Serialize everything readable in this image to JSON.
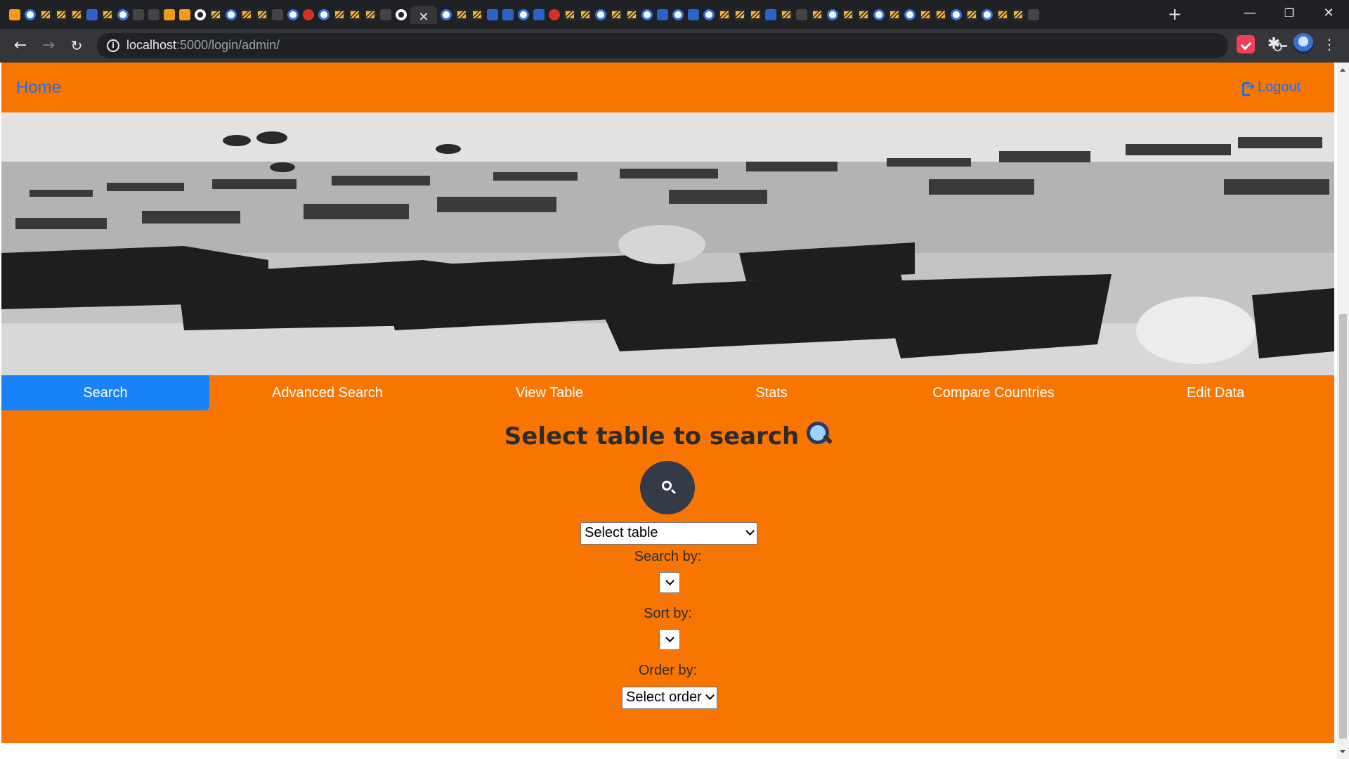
{
  "browser": {
    "url_host": "localhost",
    "url_rest": ":5000/login/admin/",
    "tab_close_glyph": "✕",
    "new_tab_glyph": "+",
    "favicons": [
      "o",
      "g",
      "w",
      "w",
      "w",
      "b",
      "w",
      "g",
      "dark",
      "dark",
      "o",
      "o",
      "c",
      "w",
      "g",
      "w",
      "w",
      "dark",
      "g",
      "r",
      "g",
      "w",
      "w",
      "w",
      "dark",
      "c",
      "active",
      "g",
      "w",
      "w",
      "b",
      "b",
      "g",
      "b",
      "r",
      "w",
      "w",
      "g",
      "w",
      "w",
      "g",
      "b",
      "g",
      "b",
      "g",
      "w",
      "w",
      "w",
      "b",
      "w",
      "dark",
      "w",
      "g",
      "w",
      "w",
      "g",
      "w",
      "g",
      "w",
      "w",
      "g",
      "w",
      "g",
      "w",
      "w",
      "dark"
    ],
    "controls": {
      "minimize": "—",
      "restore": "❐",
      "close": "✕"
    },
    "icons": [
      "back-arrow-icon",
      "forward-arrow-icon",
      "reload-icon",
      "info-icon",
      "key-icon",
      "star-icon",
      "pocket-icon",
      "puzzle-icon",
      "avatar",
      "menu-icon"
    ]
  },
  "nav": {
    "home": "Home",
    "logout": "Logout"
  },
  "tabs": [
    {
      "label": "Search",
      "active": true
    },
    {
      "label": "Advanced Search",
      "active": false
    },
    {
      "label": "View Table",
      "active": false
    },
    {
      "label": "Stats",
      "active": false
    },
    {
      "label": "Compare Countries",
      "active": false
    },
    {
      "label": "Edit Data",
      "active": false
    }
  ],
  "main": {
    "heading": "Select table to search",
    "table_select": "Select table",
    "search_by_label": "Search by:",
    "search_by_value": "",
    "sort_by_label": "Sort by:",
    "sort_by_value": "",
    "order_by_label": "Order by:",
    "order_select": "Select order"
  },
  "colors": {
    "page_bg": "#f77500",
    "active_tab": "#1a82f7",
    "link": "#1f6fe6",
    "search_button": "#343a46"
  }
}
